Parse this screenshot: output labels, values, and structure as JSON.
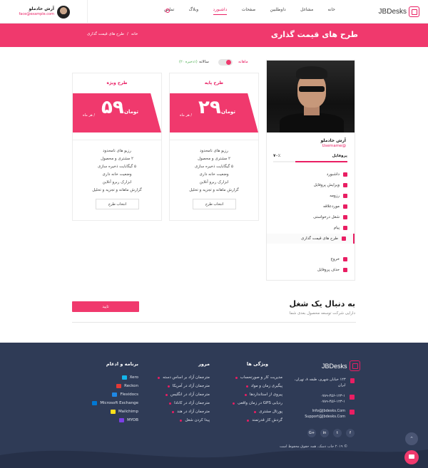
{
  "header": {
    "logo_text": "JBDesks",
    "nav": [
      "خانه",
      "مشاغل",
      "داوطلبین",
      "صفحات",
      "داشبورد",
      "وبلاگ",
      "تماس"
    ],
    "active_nav": "داشبورد",
    "user": {
      "name": "آرش خادملو",
      "email": "face@example.com"
    }
  },
  "banner": {
    "title": "طرح های قیمت گذاری",
    "breadcrumb": [
      "خانه",
      "/",
      "طرح های قیمت گذاری"
    ]
  },
  "toggle": {
    "monthly": "ماهانه",
    "yearly": "سالانه",
    "discount": "(ذخیره ۲۰٪)"
  },
  "plans": [
    {
      "title": "طرح ویژه",
      "price": "۵۹",
      "currency": "تومان",
      "per": "/ هر ماه",
      "features": [
        "رزیو های نامحدود",
        "۲ مشتری و محصول",
        "۵ گیگابایت ذخیره سازی",
        "وضعیت خانه داری",
        "ابزارک ربرو آنلاین",
        "گزارش ماهانه و تجزیه و تحلیل"
      ],
      "button": "انتخاب طرح"
    },
    {
      "title": "طرح پایه",
      "price": "۲۹",
      "currency": "تومان",
      "per": "/ هر ماه",
      "features": [
        "رزیو های نامحدود",
        "۲ مشتری و محصول",
        "۵ گیگابایت ذخیره سازی",
        "وضعیت خانه داری",
        "ابزارک ربرو آنلاین",
        "گزارش ماهانه و تجزیه و تحلیل"
      ],
      "button": "انتخاب طرح"
    }
  ],
  "sidebar": {
    "name": "آرش خادملو",
    "username": "Username@",
    "profile_label": "پروفایل",
    "percent_text": "۷۰٪",
    "percent": 0.7,
    "menu": [
      "داشبورد",
      "ویرایش پروفایل",
      "رزومه",
      "موردعلاقه",
      "شغل درخواستی",
      "پیام",
      "طرح های قیمت گذاری"
    ],
    "selected": "طرح های قیمت گذاری",
    "menu2": [
      "خروج",
      "حذف پروفایل"
    ]
  },
  "job": {
    "title": "به دنبال یک شغل",
    "subtitle": "دارایی شرکت توسعه محصول بعدی شما",
    "button": "تایید"
  },
  "footer": {
    "logo_text": "JBDesks",
    "address": "۱۲۳ خیابان شهری، طبقه ۸، تهران، ایران",
    "phones": [
      "۰۷۸۹-۴۵۶-۱۲۳-۱",
      "۰۷۸۹-۴۵۶-۱۲۳-۱"
    ],
    "emails": [
      "Info@Jbdesks.Com",
      "Support@Jbdesks.Com"
    ],
    "social": [
      "f",
      "t",
      "in",
      "G+"
    ],
    "features_title": "ویژگی ها",
    "features": [
      "مدیریت کار و صورتحساب",
      "پیگیری زمان و مواد",
      "پیروی از استانداردها",
      "ردیابی GPS در زمان واقعی",
      "پورتال مشتری",
      "گردش کار قدرتمند"
    ],
    "browse_title": "مرور",
    "browse": [
      "مترجمان آزاد بر اساس دسته",
      "مترجمان آزاد در آمریکا",
      "مترجمان آزاد در انگلیس",
      "مترجمان آزاد در کانادا",
      "مترجمان آزاد در هند",
      "پیدا کردن شغل"
    ],
    "apps_title": "برنامه و ادغام",
    "apps": [
      {
        "name": "Xero",
        "color": "#13b5ea"
      },
      {
        "name": "Reckon",
        "color": "#e53935"
      },
      {
        "name": "Flexidocs",
        "color": "#1e88e5"
      },
      {
        "name": "Microsoft Exchange",
        "color": "#0078d4"
      },
      {
        "name": "Mailchimp",
        "color": "#ffe01b"
      },
      {
        "name": "MYOB",
        "color": "#7b3fe4"
      }
    ],
    "copyright": "© ۲۰۱۹ جاب دسک. همه حقوق محفوظ است"
  }
}
